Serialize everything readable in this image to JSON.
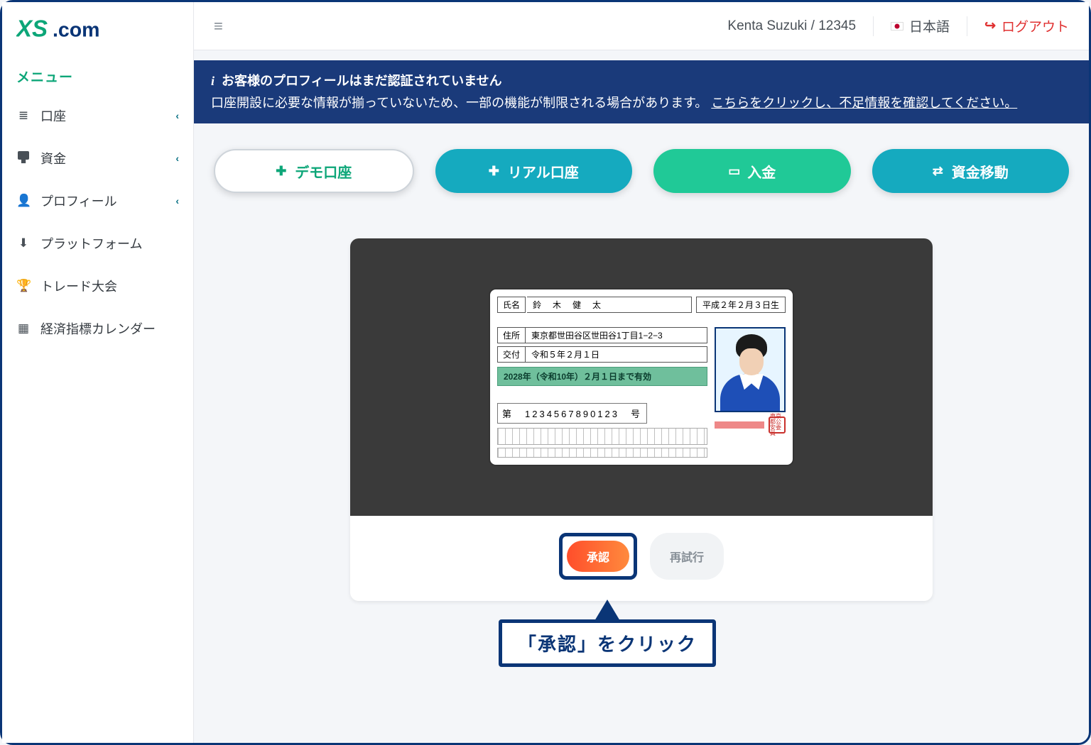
{
  "brand": {
    "name": "XS.com"
  },
  "sidebar": {
    "menu_title": "メニュー",
    "items": [
      {
        "label": "口座",
        "icon": "list-icon",
        "expandable": true
      },
      {
        "label": "資金",
        "icon": "wallet-icon",
        "expandable": true
      },
      {
        "label": "プロフィール",
        "icon": "user-icon",
        "expandable": true
      },
      {
        "label": "プラットフォーム",
        "icon": "download-icon",
        "expandable": false
      },
      {
        "label": "トレード大会",
        "icon": "trophy-icon",
        "expandable": false
      },
      {
        "label": "経済指標カレンダー",
        "icon": "calendar-icon",
        "expandable": false
      }
    ]
  },
  "topbar": {
    "user": "Kenta Suzuki / 12345",
    "language": "日本語",
    "logout": "ログアウト"
  },
  "banner": {
    "title": "お客様のプロフィールはまだ認証されていません",
    "body_prefix": "口座開設に必要な情報が揃っていないため、一部の機能が制限される場合があります。 ",
    "link": "こちらをクリックし、不足情報を確認してください。"
  },
  "actions": {
    "demo": "デモ口座",
    "real": "リアル口座",
    "deposit": "入金",
    "transfer": "資金移動"
  },
  "id_card": {
    "name_label": "氏名",
    "name_value": "鈴　木　健　太",
    "dob": "平成２年２月３日生",
    "address_label": "住所",
    "address_value": "東京都世田谷区世田谷1丁目1−2−3",
    "issue_label": "交付",
    "issue_value": "令和５年２月１日",
    "valid_until": "2028年（令和10年）２月１日まで有効",
    "number_line": "第　1234567890123　号",
    "stamp": "東京都公安委員"
  },
  "verify_buttons": {
    "approve": "承認",
    "retry": "再試行"
  },
  "callout": "「承認」をクリック"
}
